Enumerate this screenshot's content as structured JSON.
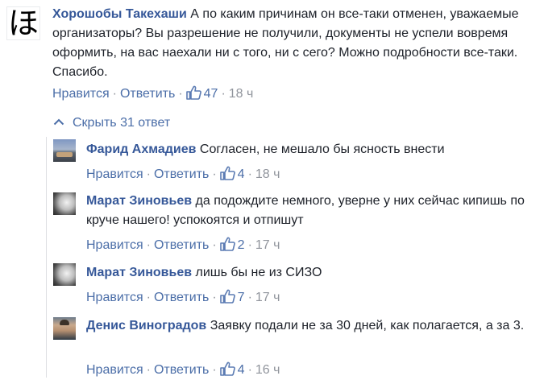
{
  "main_comment": {
    "author": "Хорошобы Такехаши",
    "text": "А по каким причинам он все-таки отменен, уважаемые организаторы? Вы разрешение не получили, документы не успели вовремя оформить, на вас наехали ни с того, ни с сего? Можно подробности все-таки. Спасибо.",
    "like_label": "Нравится",
    "reply_label": "Ответить",
    "likes": "47",
    "time": "18 ч",
    "avatar_glyph": "ほ"
  },
  "toggle_replies": {
    "label": "Скрыть 31 ответ"
  },
  "replies": [
    {
      "author": "Фарид Ахмадиев",
      "text": "Согласен, не мешало бы ясность внести",
      "like_label": "Нравится",
      "reply_label": "Ответить",
      "likes": "4",
      "time": "18 ч"
    },
    {
      "author": "Марат Зиновьев",
      "text": "да подождите немного, уверне у них сейчас кипишь по круче нашего! успокоятся и отпишут",
      "like_label": "Нравится",
      "reply_label": "Ответить",
      "likes": "2",
      "time": "17 ч"
    },
    {
      "author": "Марат Зиновьев",
      "text": "лишь бы не из СИЗО",
      "like_label": "Нравится",
      "reply_label": "Ответить",
      "likes": "7",
      "time": "17 ч"
    },
    {
      "author": "Денис Виноградов",
      "text": "Заявку подали не за 30 дней, как полагается, а за 3.",
      "like_label": "Нравится",
      "reply_label": "Ответить",
      "likes": "4",
      "time": "16 ч"
    }
  ],
  "colors": {
    "link": "#365899",
    "action": "#4b6ea8",
    "muted": "#90949c",
    "text": "#1d2129"
  }
}
